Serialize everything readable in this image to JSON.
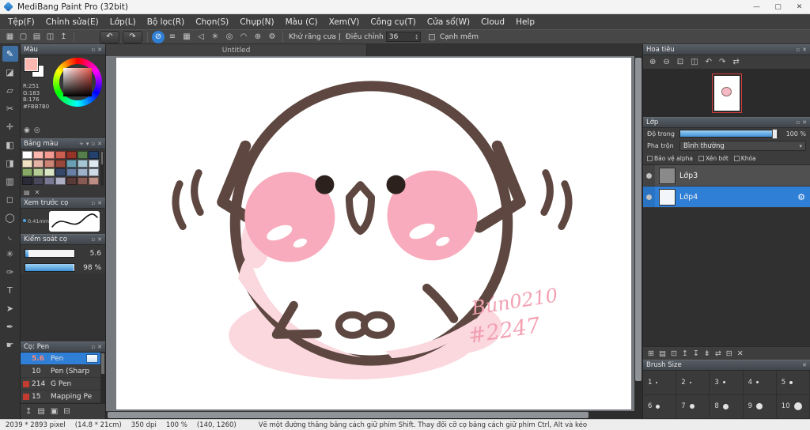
{
  "window": {
    "title": "MediBang Paint Pro (32bit)",
    "minimize": "—",
    "maximize": "▢",
    "close": "✕"
  },
  "menubar": {
    "items": [
      "Tệp(F)",
      "Chỉnh sửa(E)",
      "Lớp(L)",
      "Bộ lọc(R)",
      "Chọn(S)",
      "Chụp(N)",
      "Màu (C)",
      "Xem(V)",
      "Công cụ(T)",
      "Cửa sổ(W)",
      "Cloud",
      "Help"
    ]
  },
  "toolbar": {
    "file_icons": [
      {
        "name": "grid-view-icon",
        "glyph": "▦"
      },
      {
        "name": "new-canvas-icon",
        "glyph": "▢"
      },
      {
        "name": "open-file-icon",
        "glyph": "▤"
      },
      {
        "name": "save-icon",
        "glyph": "◫"
      },
      {
        "name": "export-icon",
        "glyph": "↥"
      }
    ],
    "undo_icon": "↶",
    "redo_icon": "↷",
    "snap_icons": [
      {
        "name": "snap-off-icon",
        "glyph": "⊘",
        "selected": true
      },
      {
        "name": "snap-parallel-icon",
        "glyph": "≡"
      },
      {
        "name": "snap-crosshatch-icon",
        "glyph": "▦"
      },
      {
        "name": "snap-vanishing-point-icon",
        "glyph": "◁"
      },
      {
        "name": "snap-radial-icon",
        "glyph": "✳"
      },
      {
        "name": "snap-circle-icon",
        "glyph": "◎"
      },
      {
        "name": "snap-curve-icon",
        "glyph": "◠"
      },
      {
        "name": "snap-add-icon",
        "glyph": "⊕"
      },
      {
        "name": "snap-settings-icon",
        "glyph": "⚙"
      }
    ],
    "antialias_label": "Khử răng cưa |",
    "adjust_label": "Điều chỉnh",
    "adjust_value": "36",
    "soft_edge_label": "Cạnh mềm"
  },
  "tools": [
    {
      "name": "brush-tool",
      "glyph": "✎",
      "selected": true
    },
    {
      "name": "eraser-tool",
      "glyph": "◪"
    },
    {
      "name": "smudge-tool",
      "glyph": "▱"
    },
    {
      "name": "divide-tool",
      "glyph": "✂"
    },
    {
      "name": "move-tool",
      "glyph": "✛"
    },
    {
      "name": "fill-rect-tool",
      "glyph": "◧"
    },
    {
      "name": "bucket-tool",
      "glyph": "◨"
    },
    {
      "name": "gradient-tool",
      "glyph": "▥"
    },
    {
      "name": "select-rect-tool",
      "glyph": "◻"
    },
    {
      "name": "select-ellipse-tool",
      "glyph": "◯"
    },
    {
      "name": "lasso-tool",
      "glyph": "◟"
    },
    {
      "name": "magic-wand-tool",
      "glyph": "✳"
    },
    {
      "name": "select-pen-tool",
      "glyph": "✑"
    },
    {
      "name": "text-tool",
      "glyph": "T"
    },
    {
      "name": "operation-tool",
      "glyph": "➤"
    },
    {
      "name": "eyedropper-tool",
      "glyph": "✒"
    },
    {
      "name": "hand-tool",
      "glyph": "☛"
    }
  ],
  "color_panel": {
    "title": "Màu",
    "fg_color": "#FBB7B0",
    "r": "R:251",
    "g": "G:183",
    "b": "B:176",
    "hex": "#FBB7B0",
    "rgb_icon": "◉",
    "hsv_icon": "◎"
  },
  "palette_panel": {
    "title": "Bảng màu",
    "add_icon": "+",
    "menu_icon": "▾",
    "colors": [
      "#ffffff",
      "#fbb7b0",
      "#f49a92",
      "#cc5f52",
      "#96342a",
      "#55804c",
      "#24416e",
      "#f2e2c4",
      "#e5b2a6",
      "#cc8474",
      "#98483a",
      "#6aa0b4",
      "#a6c6d6",
      "#dfeaf0",
      "#88a868",
      "#b6cc96",
      "#d9e6c6",
      "#36486a",
      "#6880a6",
      "#9eb2ca",
      "#cedae6",
      "#2a2a38",
      "#48485a",
      "#787892",
      "#aeaec2",
      "#583a38",
      "#885a54",
      "#bc8e86"
    ],
    "footer_icons": [
      {
        "name": "add-color-icon",
        "glyph": "▤"
      },
      {
        "name": "delete-color-icon",
        "glyph": "✕"
      }
    ]
  },
  "preview_panel": {
    "title": "Xem trước cọ",
    "size_label": "0.41mm"
  },
  "control_panel": {
    "title": "Kiểm soát cọ",
    "size_value": "5.6",
    "opacity_value": "98 %"
  },
  "brush_panel": {
    "title": "Cọ: Pen",
    "items": [
      {
        "size": "5.6",
        "name": "Pen",
        "selected": true,
        "chip": ""
      },
      {
        "size": "10",
        "name": "Pen (Sharp",
        "chip": ""
      },
      {
        "size": "214",
        "name": "G Pen",
        "chip": "#c43b2f"
      },
      {
        "size": "15",
        "name": "Mapping Pe",
        "chip": "#c43b2f"
      }
    ],
    "footer_icons": [
      {
        "name": "upload-brush-icon",
        "glyph": "↥"
      },
      {
        "name": "add-brush-icon",
        "glyph": "▤"
      },
      {
        "name": "brush-folder-icon",
        "glyph": "▣"
      },
      {
        "name": "delete-brush-icon",
        "glyph": "⊟"
      }
    ]
  },
  "navigator_panel": {
    "title": "Hoa tiêu",
    "icons": [
      {
        "name": "zoom-in-icon",
        "glyph": "⊕"
      },
      {
        "name": "zoom-out-icon",
        "glyph": "⊖"
      },
      {
        "name": "zoom-fit-icon",
        "glyph": "⊡"
      },
      {
        "name": "zoom-100-icon",
        "glyph": "◫"
      },
      {
        "name": "rotate-left-icon",
        "glyph": "↶"
      },
      {
        "name": "rotate-right-icon",
        "glyph": "↷"
      },
      {
        "name": "flip-horizontal-icon",
        "glyph": "⇄"
      }
    ]
  },
  "layers_panel": {
    "title": "Lớp",
    "opacity_label": "Độ trong",
    "opacity_value": "100 %",
    "blend_label": "Pha trộn",
    "blend_value": "Bình thường",
    "checks": [
      "Bảo vệ alpha",
      "Xén bớt",
      "Khóa"
    ],
    "gear_icon": "⚙",
    "layers": [
      {
        "name": "Lớp3",
        "thumb": "#8a8a8a",
        "selected": false
      },
      {
        "name": "Lớp4",
        "thumb": "#f2f6fa",
        "selected": true
      }
    ],
    "action_icons": [
      {
        "name": "add-layer-icon",
        "glyph": "⊞"
      },
      {
        "name": "add-folder-icon",
        "glyph": "▤"
      },
      {
        "name": "duplicate-layer-icon",
        "glyph": "⊡"
      },
      {
        "name": "layer-up-icon",
        "glyph": "↥"
      },
      {
        "name": "layer-down-icon",
        "glyph": "↧"
      },
      {
        "name": "merge-layer-icon",
        "glyph": "⇟"
      },
      {
        "name": "transfer-layer-icon",
        "glyph": "⇄"
      },
      {
        "name": "clear-layer-icon",
        "glyph": "⊟"
      },
      {
        "name": "delete-layer-icon",
        "glyph": "✕"
      }
    ]
  },
  "brush_size_panel": {
    "title": "Brush Size",
    "cells": [
      {
        "label": "1",
        "dot": 2
      },
      {
        "label": "2",
        "dot": 2
      },
      {
        "label": "3",
        "dot": 3
      },
      {
        "label": "4",
        "dot": 3
      },
      {
        "label": "5",
        "dot": 4
      },
      {
        "label": "6",
        "dot": 5
      },
      {
        "label": "7",
        "dot": 6
      },
      {
        "label": "8",
        "dot": 7
      },
      {
        "label": "9",
        "dot": 8
      },
      {
        "label": "10",
        "dot": 10
      }
    ]
  },
  "canvas": {
    "tab": "Untitled",
    "signature1": "Bún0210",
    "signature2": "#2247",
    "art_colors": {
      "outline": "#5d4740",
      "cheek": "#f8abbc",
      "shade": "#fbd7de",
      "signature": "#f2a0b2"
    }
  },
  "statusbar": {
    "size": "2039 * 2893 pixel",
    "dims": "(14.8 * 21cm)",
    "dpi": "350 dpi",
    "zoom": "100 %",
    "coords": "(140, 1260)",
    "hint": "Vẽ một đường thẳng bằng cách giữ phím Shift. Thay đổi cỡ cọ bằng cách giữ phím Ctrl, Alt và kéo"
  },
  "chrome": {
    "collapse_icon": "▫",
    "close_icon": "✕",
    "accent": "#2f7fd6"
  }
}
